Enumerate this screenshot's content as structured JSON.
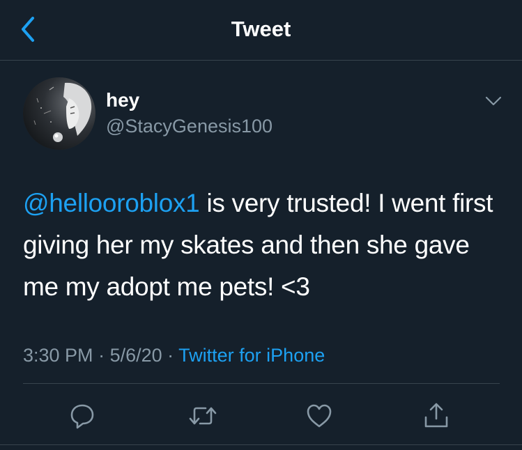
{
  "header": {
    "title": "Tweet",
    "back_icon": "chevron-left-icon"
  },
  "tweet": {
    "author": {
      "display_name": "hey",
      "handle": "@StacyGenesis100"
    },
    "text": {
      "mention": "@hellooroblox1",
      "body": " is very trusted! I went first giving her my skates and then she gave me my adopt me pets! <3"
    },
    "meta": {
      "time": "3:30 PM",
      "separator": " · ",
      "date": "5/6/20",
      "separator2": " · ",
      "source": "Twitter for iPhone"
    },
    "actions": [
      "reply-icon",
      "retweet-icon",
      "like-icon",
      "share-icon"
    ]
  },
  "colors": {
    "background": "#15202b",
    "accent": "#1da1f2",
    "secondary_text": "#8899a6",
    "divider": "#38444d"
  }
}
